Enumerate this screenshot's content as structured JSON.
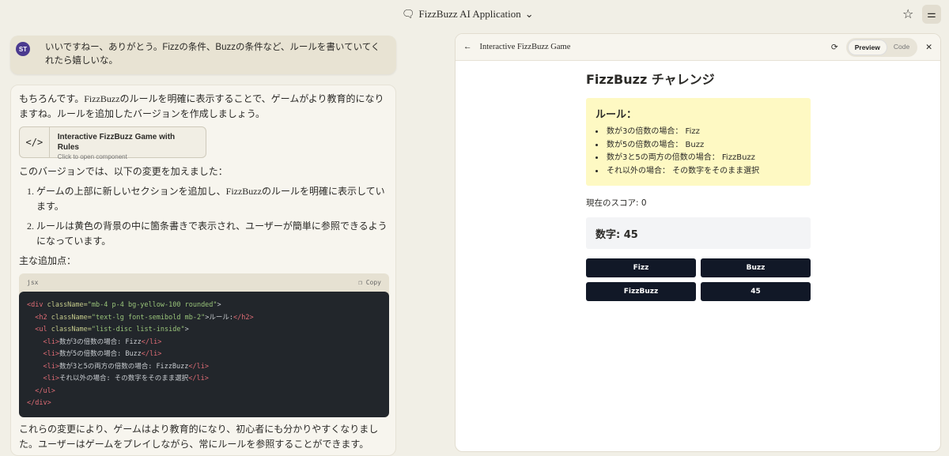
{
  "header": {
    "title": "FizzBuzz AI Application"
  },
  "user_message": {
    "initials": "ST",
    "text": "いいですねー、ありがとう。Fizzの条件、Buzzの条件など、ルールを書いていてくれたら嬉しいな。"
  },
  "assistant": {
    "intro": "もちろんです。FizzBuzzのルールを明確に表示することで、ゲームがより教育的になりますね。ルールを追加したバージョンを作成しましょう。",
    "artifact": {
      "title": "Interactive FizzBuzz Game with Rules",
      "subtitle": "Click to open component"
    },
    "changes_intro": "このバージョンでは、以下の変更を加えました：",
    "changes": [
      "ゲームの上部に新しいセクションを追加し、FizzBuzzのルールを明確に表示しています。",
      "ルールは黄色の背景の中に箇条書きで表示され、ユーザーが簡単に参照できるようになっています。"
    ],
    "additions_label": "主な追加点：",
    "code": {
      "lang": "jsx",
      "copy": "Copy",
      "lines": [
        [
          [
            "tg",
            "<div "
          ],
          [
            "at",
            "className="
          ],
          [
            "st",
            "\"mb-4 p-4 bg-yellow-100 rounded\""
          ],
          [
            "",
            ">"
          ]
        ],
        [
          [
            "",
            "  "
          ],
          [
            "tg",
            "<h2 "
          ],
          [
            "at",
            "className="
          ],
          [
            "st",
            "\"text-lg font-semibold mb-2\""
          ],
          [
            "",
            ">ルール:"
          ],
          [
            "tg",
            "</h2>"
          ]
        ],
        [
          [
            "",
            "  "
          ],
          [
            "tg",
            "<ul "
          ],
          [
            "at",
            "className="
          ],
          [
            "st",
            "\"list-disc list-inside\""
          ],
          [
            "",
            ">"
          ]
        ],
        [
          [
            "",
            "    "
          ],
          [
            "tg",
            "<li>"
          ],
          [
            "",
            "数が3の倍数の場合: Fizz"
          ],
          [
            "tg",
            "</li>"
          ]
        ],
        [
          [
            "",
            "    "
          ],
          [
            "tg",
            "<li>"
          ],
          [
            "",
            "数が5の倍数の場合: Buzz"
          ],
          [
            "tg",
            "</li>"
          ]
        ],
        [
          [
            "",
            "    "
          ],
          [
            "tg",
            "<li>"
          ],
          [
            "",
            "数が3と5の両方の倍数の場合: FizzBuzz"
          ],
          [
            "tg",
            "</li>"
          ]
        ],
        [
          [
            "",
            "    "
          ],
          [
            "tg",
            "<li>"
          ],
          [
            "",
            "それ以外の場合: その数字をそのまま選択"
          ],
          [
            "tg",
            "</li>"
          ]
        ],
        [
          [
            "",
            "  "
          ],
          [
            "tg",
            "</ul>"
          ]
        ],
        [
          [
            "tg",
            "</div>"
          ]
        ]
      ]
    },
    "conclusion": "これらの変更により、ゲームはより教育的になり、初心者にも分かりやすくなりました。ユーザーはゲームをプレイしながら、常にルールを参照することができます。"
  },
  "panel": {
    "title": "Interactive FizzBuzz Game",
    "tabs": [
      "Preview",
      "Code"
    ]
  },
  "game": {
    "title": "FizzBuzz チャレンジ",
    "rules_title": "ルール：",
    "rules": [
      "数が3の倍数の場合： Fizz",
      "数が5の倍数の場合： Buzz",
      "数が3と5の両方の倍数の場合： FizzBuzz",
      "それ以外の場合： その数字をそのまま選択"
    ],
    "score": "現在のスコア: 0",
    "number": "数字: 45",
    "buttons": [
      "Fizz",
      "Buzz",
      "FizzBuzz",
      "45"
    ]
  }
}
